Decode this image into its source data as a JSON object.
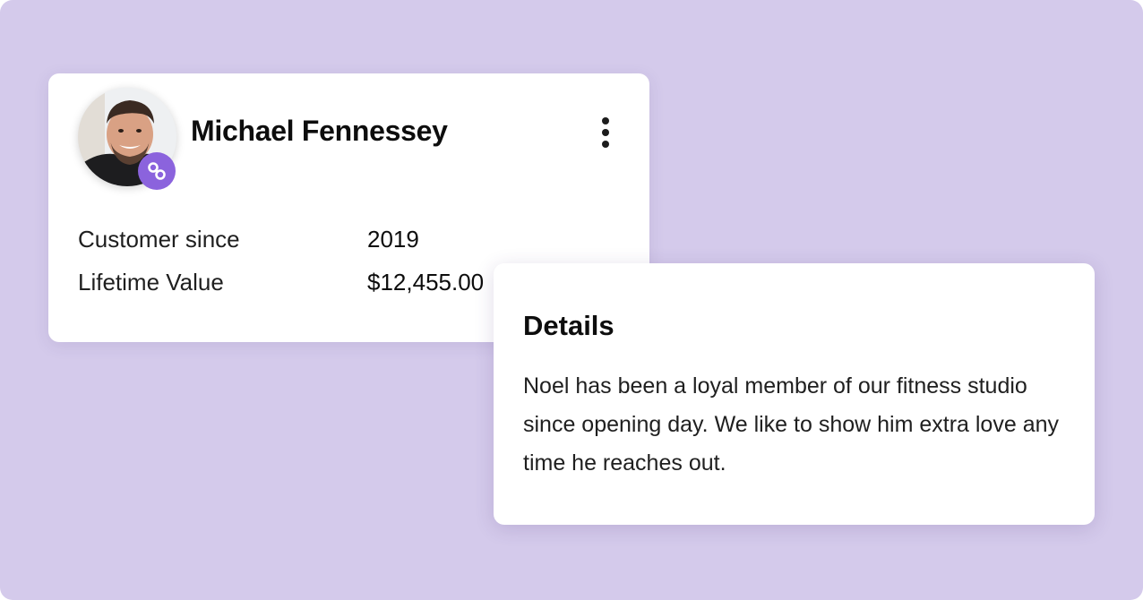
{
  "profile": {
    "name": "Michael Fennessey",
    "avatar_icon": "user-photo",
    "badge_icon": "link-icon",
    "badge_color": "#8b63dd",
    "menu_icon": "kebab-menu-icon",
    "fields": [
      {
        "label": "Customer since",
        "value": "2019"
      },
      {
        "label": "Lifetime Value",
        "value": "$12,455.00"
      }
    ]
  },
  "details": {
    "title": "Details",
    "text": "Noel has been a loyal member of our fitness studio since opening day. We like to show him extra love any time he reaches out."
  },
  "colors": {
    "background": "#d4caeb",
    "card": "#ffffff",
    "accent": "#8b63dd"
  }
}
